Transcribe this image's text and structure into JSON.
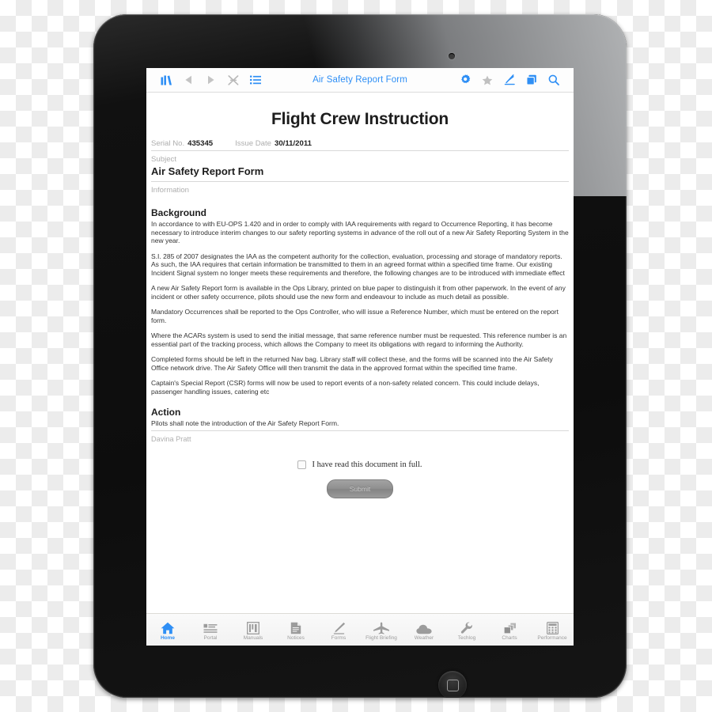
{
  "toolbar": {
    "title": "Air Safety Report Form",
    "left_icons": [
      {
        "name": "library-icon",
        "label": "Library",
        "color": "#2f8ff5"
      },
      {
        "name": "back-arrow-icon",
        "label": "Back",
        "color": "#c4c4c4"
      },
      {
        "name": "forward-arrow-icon",
        "label": "Forward",
        "color": "#c4c4c4"
      },
      {
        "name": "airplane-icon",
        "label": "Flight Mode",
        "color": "#b9b9b9"
      },
      {
        "name": "list-icon",
        "label": "Contents",
        "color": "#2f8ff5"
      }
    ],
    "right_icons": [
      {
        "name": "gear-icon",
        "label": "Settings",
        "color": "#2f8ff5"
      },
      {
        "name": "star-icon",
        "label": "Favourite",
        "color": "#c0c0c0"
      },
      {
        "name": "pen-icon",
        "label": "Annotate",
        "color": "#2f8ff5"
      },
      {
        "name": "copy-pages-icon",
        "label": "Pages",
        "color": "#2f8ff5"
      },
      {
        "name": "search-icon",
        "label": "Search",
        "color": "#2f8ff5"
      }
    ]
  },
  "document": {
    "title": "Flight Crew Instruction",
    "serial_label": "Serial No.",
    "serial_value": "435345",
    "issue_date_label": "Issue Date",
    "issue_date_value": "30/11/2011",
    "subject_label": "Subject",
    "subject_value": "Air Safety Report Form",
    "information_label": "Information",
    "background_heading": "Background",
    "paragraphs": [
      "In accordance to with EU-OPS 1.420 and in order to comply with IAA requirements with regard to Occurrence Reporting, it has become necessary to introduce interim changes to our safety reporting systems in advance of the roll out of a new Air Safety Reporting System in the new year.",
      "S.I. 285 of 2007 designates the IAA as the competent authority for the collection, evaluation, processing and storage of mandatory reports. As such, the IAA requires that certain information be transmitted to them in an agreed format within a specified time frame. Our existing Incident Signal system no longer meets these requirements and therefore, the following changes are to be introduced with immediate effect",
      "A new Air Safety Report form is available in the Ops Library, printed on blue paper to distinguish it from other paperwork. In the event of any incident or other safety occurrence, pilots should use the new form and endeavour to include as much detail as possible.",
      "Mandatory Occurrences shall be reported to the Ops Controller, who will issue a Reference Number, which must be entered on the report form.",
      "Where the ACARs system is used to send the initial message, that same reference number must be requested. This reference number is an essential part of the tracking process, which allows the Company to meet its obligations with regard to informing the Authority.",
      "Completed forms should be left in the returned Nav bag. Library staff will collect these, and the forms will be scanned into the Air Safety Office network drive. The Air Safety Office will then transmit the data in the approved format within the specified time frame.",
      "Captain's Special Report (CSR) forms will now be used to report events of a non-safety related concern. This could include delays, passenger handling issues, catering etc"
    ],
    "action_heading": "Action",
    "action_text": "Pilots shall note the introduction of the Air Safety Report Form.",
    "signature": "Davina Pratt",
    "consent_label": "I have read this document in full.",
    "submit_label": "Submit"
  },
  "tabbar": {
    "items": [
      {
        "label": "Home",
        "icon": "home-icon",
        "active": true
      },
      {
        "label": "Portal",
        "icon": "portal-icon",
        "active": false
      },
      {
        "label": "Manuals",
        "icon": "manuals-icon",
        "active": false
      },
      {
        "label": "Notices",
        "icon": "notices-icon",
        "active": false
      },
      {
        "label": "Forms",
        "icon": "forms-pen-icon",
        "active": false
      },
      {
        "label": "Flight Briefing",
        "icon": "airplane-icon",
        "active": false
      },
      {
        "label": "Weather",
        "icon": "cloud-icon",
        "active": false
      },
      {
        "label": "Techlog",
        "icon": "wrench-icon",
        "active": false
      },
      {
        "label": "Charts",
        "icon": "charts-stack-icon",
        "active": false
      },
      {
        "label": "Performance",
        "icon": "calculator-icon",
        "active": false
      }
    ]
  },
  "colors": {
    "accent": "#2f8ff5",
    "muted": "#aeaeae",
    "text": "#1d1d1d"
  }
}
